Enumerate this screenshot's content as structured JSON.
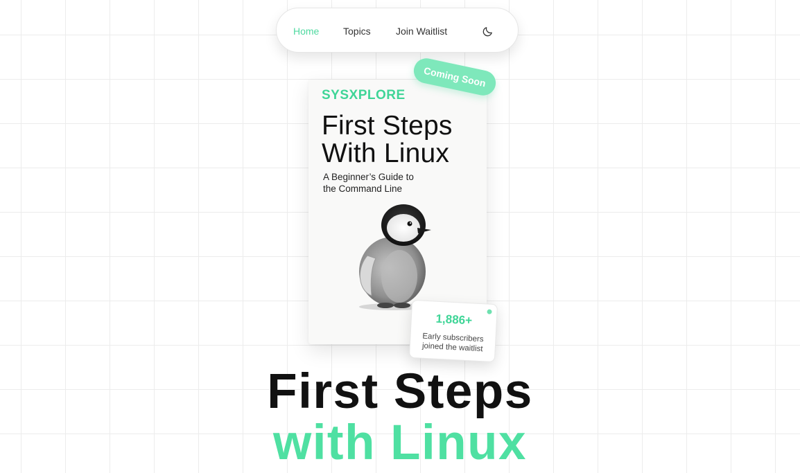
{
  "nav": {
    "links": [
      {
        "label": "Home",
        "active": true
      },
      {
        "label": "Topics",
        "active": false
      },
      {
        "label": "Join Waitlist",
        "active": false
      }
    ],
    "theme_toggle_icon": "moon-icon"
  },
  "book": {
    "brand": "SYSXPLORE",
    "title_lines": [
      "First Steps",
      "With Linux"
    ],
    "subtitle_lines": [
      "A Beginner’s Guide to",
      "the Command Line"
    ],
    "illustration": "penguin-illustration"
  },
  "badge": {
    "label": "Coming Soon"
  },
  "subscribers": {
    "count": "1,886+",
    "text_lines": [
      "Early subscribers",
      "joined the waitlist"
    ]
  },
  "hero": {
    "line1": "First Steps",
    "line2": "with Linux"
  },
  "colors": {
    "accent": "#4fe0a2",
    "brand": "#3fd597",
    "badge": "#7ee8bb",
    "text": "#111111",
    "grid": "#ececec"
  }
}
